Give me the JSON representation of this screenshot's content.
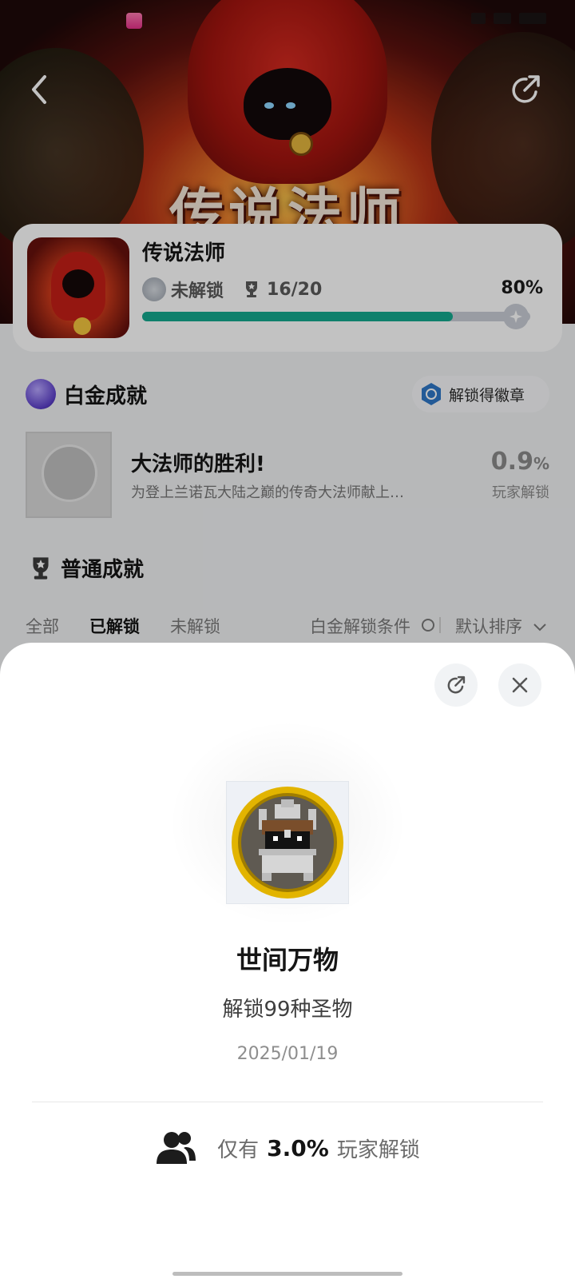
{
  "game": {
    "title": "传说法师",
    "lock_status": "未解锁",
    "trophy_count": "16/20",
    "progress_text": "80%",
    "progress": 0.8
  },
  "platinum": {
    "section_title": "白金成就",
    "badge_button_label": "解锁得徽章",
    "achievement": {
      "name": "大法师的胜利!",
      "description": "为登上兰诺瓦大陆之巅的传奇大法师献上…",
      "rate": "0.9",
      "rate_unit": "%",
      "rate_label": "玩家解锁"
    }
  },
  "normal": {
    "section_title": "普通成就",
    "tabs": [
      "全部",
      "已解锁",
      "未解锁"
    ],
    "active_tab": "已解锁",
    "filter_label": "白金解锁条件",
    "sort_label": "默认排序"
  },
  "detail_sheet": {
    "title": "世间万物",
    "description": "解锁99种圣物",
    "date": "2025/01/19",
    "rate_prefix": "仅有",
    "rate_value": "3.0%",
    "rate_suffix": "玩家解锁"
  },
  "colors": {
    "progress_fill": "#14a98e",
    "progress_track": "#c9ced6",
    "medal_gold": "#e2b400",
    "sheet_background": "#ffffff"
  },
  "icons": {
    "back": "chevron-left-icon",
    "share": "share-icon",
    "close": "close-icon",
    "trophy": "trophy-icon",
    "users": "users-icon",
    "search": "search-icon",
    "sort": "chevron-down-icon"
  }
}
